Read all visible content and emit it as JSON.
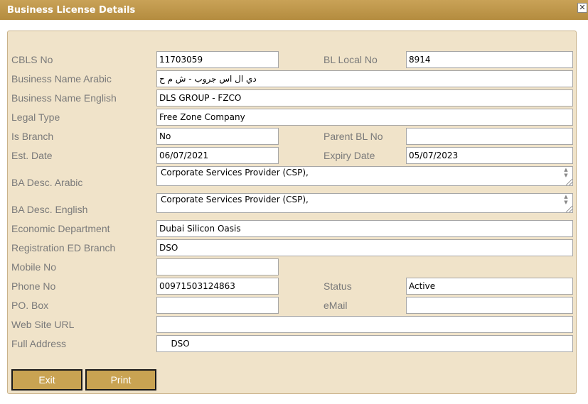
{
  "window": {
    "title": "Business License Details",
    "close_glyph": "✕"
  },
  "fields": {
    "cbls_no": {
      "label": "CBLS No",
      "value": "11703059"
    },
    "bl_local_no": {
      "label": "BL Local No",
      "value": "8914"
    },
    "name_arabic": {
      "label": "Business Name Arabic",
      "value": "دي ال اس جروب - ش م ح"
    },
    "name_english": {
      "label": "Business Name English",
      "value": "DLS GROUP - FZCO"
    },
    "legal_type": {
      "label": "Legal Type",
      "value": "Free Zone Company"
    },
    "is_branch": {
      "label": "Is Branch",
      "value": "No"
    },
    "parent_bl_no": {
      "label": "Parent BL No",
      "value": ""
    },
    "est_date": {
      "label": "Est. Date",
      "value": "06/07/2021"
    },
    "expiry_date": {
      "label": "Expiry Date",
      "value": "05/07/2023"
    },
    "ba_desc_arabic": {
      "label": "BA Desc. Arabic",
      "value": "Corporate Services Provider (CSP),"
    },
    "ba_desc_english": {
      "label": "BA Desc. English",
      "value": "Corporate Services Provider (CSP),"
    },
    "economic_department": {
      "label": "Economic Department",
      "value": "Dubai Silicon Oasis"
    },
    "registration_ed_branch": {
      "label": "Registration ED Branch",
      "value": "DSO"
    },
    "mobile_no": {
      "label": "Mobile No",
      "value": ""
    },
    "phone_no": {
      "label": "Phone No",
      "value": "00971503124863"
    },
    "status": {
      "label": "Status",
      "value": "Active"
    },
    "po_box": {
      "label": "PO. Box",
      "value": ""
    },
    "email": {
      "label": "eMail",
      "value": ""
    },
    "website_url": {
      "label": "Web Site URL",
      "value": ""
    },
    "full_address": {
      "label": "Full Address",
      "value": "   DSO"
    }
  },
  "buttons": {
    "exit": "Exit",
    "print": "Print"
  },
  "colors": {
    "title_bar": "#b48c3f",
    "panel": "#f0e3c9",
    "button": "#c9a352",
    "label": "#7a7a7a"
  }
}
